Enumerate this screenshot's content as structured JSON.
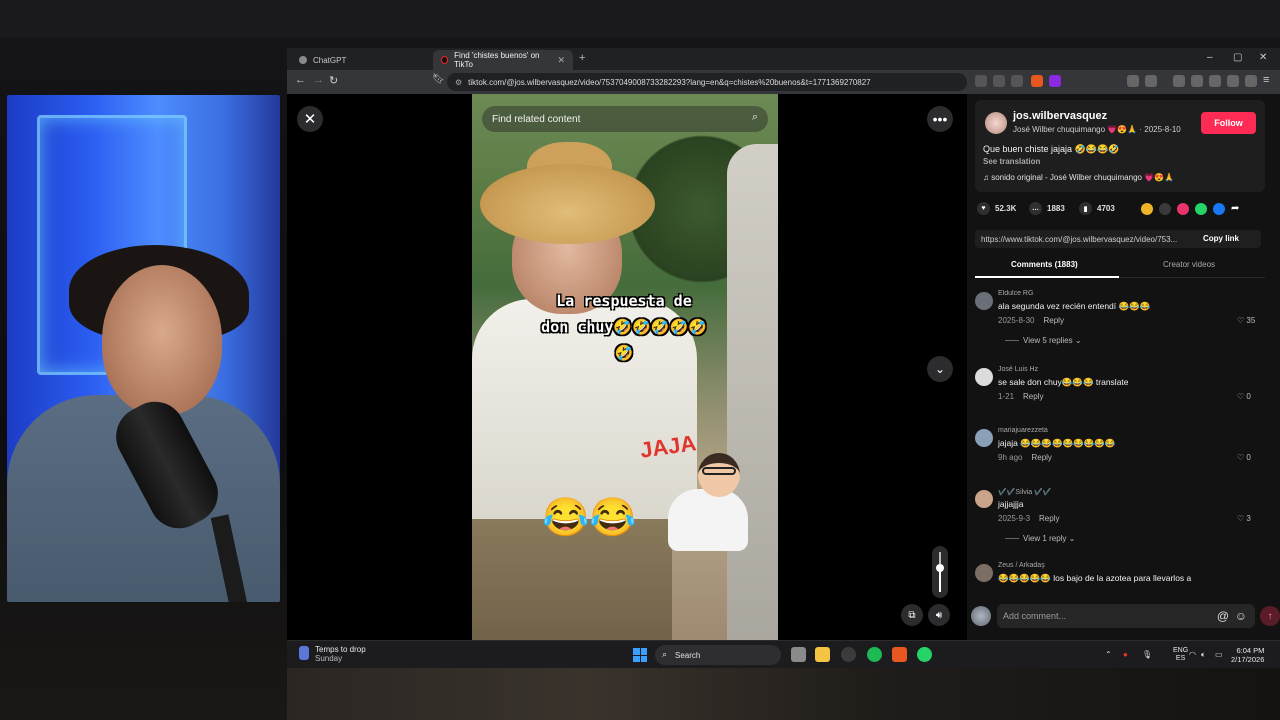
{
  "browser": {
    "tabs": [
      {
        "label": "ChatGPT",
        "active": false
      },
      {
        "label": "Find 'chistes buenos' on TikTo",
        "active": true
      }
    ],
    "url": "tiktok.com/@jos.wilbervasquez/video/7537049008733282293?lang=en&q=chistes%20buenos&t=1771369270827"
  },
  "video": {
    "search_placeholder": "Find related content",
    "caption_line1": "La respuesta de",
    "caption_line2": "don chuy🤣🤣🤣🤣🤣",
    "caption_line3": "🤣",
    "sticker_text": "JAJA",
    "emoji_overlay": "😂😂",
    "volume_level_percent": 60
  },
  "post": {
    "username": "jos.wilbervasquez",
    "display_name": "José Wilber chuquimango 💗😍🙏",
    "date": "2025-8-10",
    "follow_label": "Follow",
    "description": "Que buen chiste jajaja 🤣😂😂🤣",
    "see_translation": "See translation",
    "sound": "♫  sonido original - José Wilber chuquimango 💗😍🙏",
    "likes": "52.3K",
    "comments_count": "1883",
    "saves": "4703",
    "link": "https://www.tiktok.com/@jos.wilbervasquez/video/753...",
    "copy_link": "Copy link",
    "tab_comments": "Comments (1883)",
    "tab_creator": "Creator videos"
  },
  "comments": [
    {
      "name": "Eldulce RG",
      "text": "ala segunda vez recién entendí 😂😂😂",
      "meta": "2025-8-30",
      "reply": "Reply",
      "likes": "35",
      "view_replies": "View 5 replies ⌄"
    },
    {
      "name": "José Luis Hz",
      "text": "se sale don chuy😂😂😂 translate",
      "meta": "1-21",
      "reply": "Reply",
      "likes": "0"
    },
    {
      "name": "mariajuarezzeta",
      "text": "jajaja 😂😂😂😂😂😂😂😂😂",
      "meta": "9h ago",
      "reply": "Reply",
      "likes": "0"
    },
    {
      "name": "✔️✔️Silvia ✔️✔️",
      "text": "jajjajjja",
      "meta": "2025-9-3",
      "reply": "Reply",
      "likes": "3",
      "view_replies": "View 1 reply ⌄"
    },
    {
      "name": "Zeus / Arkadaş",
      "text": "😂😂😂😂😂 los bajo de la azotea para llevarlos a"
    }
  ],
  "comment_input": {
    "placeholder": "Add comment..."
  },
  "taskbar": {
    "weather_line1": "Temps to drop",
    "weather_line2": "Sunday",
    "search": "Search",
    "lang1": "ENG",
    "lang2": "ES",
    "time": "6:04 PM",
    "date": "2/17/2026"
  },
  "colors": {
    "accent": "#fe2c55",
    "panel": "#121212"
  }
}
